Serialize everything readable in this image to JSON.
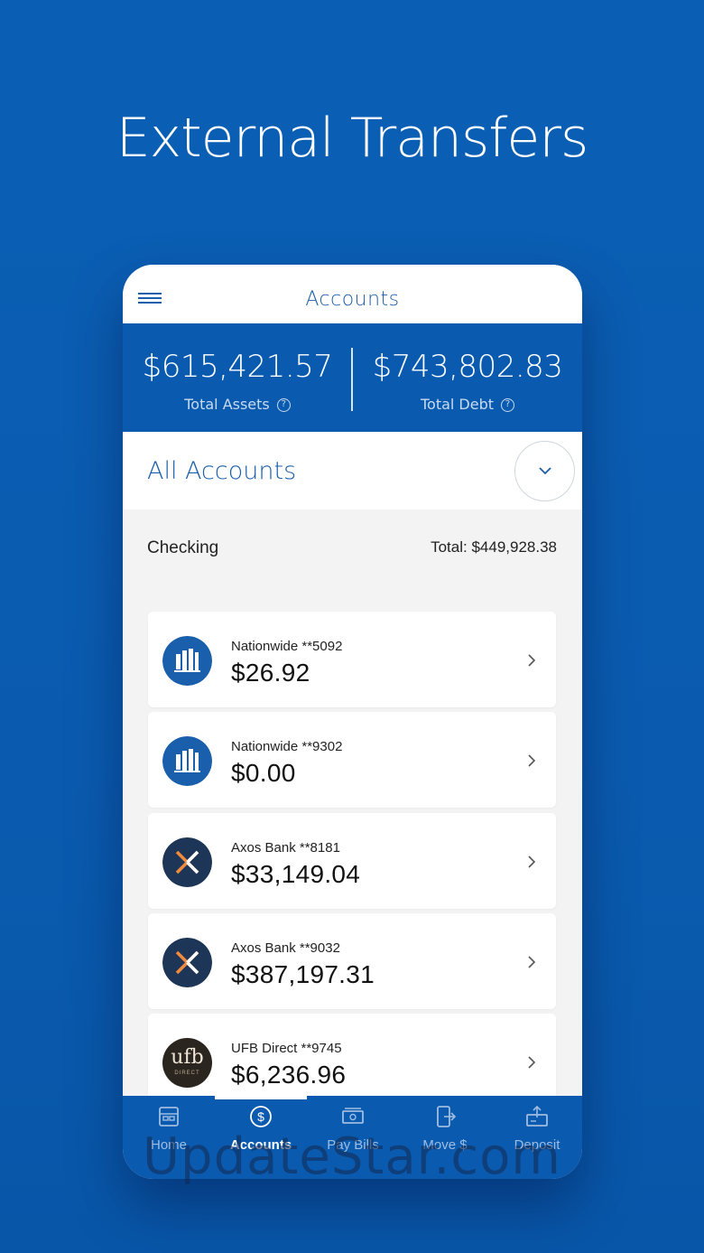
{
  "hero": {
    "title": "External Transfers"
  },
  "header": {
    "title": "Accounts"
  },
  "summary": {
    "assets_amount": "$615,421.57",
    "assets_label": "Total Assets",
    "debt_amount": "$743,802.83",
    "debt_label": "Total Debt",
    "help_glyph": "?"
  },
  "filter": {
    "label": "All Accounts"
  },
  "section": {
    "name": "Checking",
    "total": "Total:  $449,928.38"
  },
  "accounts": [
    {
      "name": "Nationwide **5092",
      "balance": "$26.92",
      "logo": "nationwide-logo"
    },
    {
      "name": "Nationwide **9302",
      "balance": "$0.00",
      "logo": "nationwide-logo"
    },
    {
      "name": "Axos Bank **8181",
      "balance": "$33,149.04",
      "logo": "axos-logo"
    },
    {
      "name": "Axos Bank **9032",
      "balance": "$387,197.31",
      "logo": "axos-logo"
    },
    {
      "name": "UFB Direct **9745",
      "balance": "$6,236.96",
      "logo": "ufb-logo"
    }
  ],
  "ufb_logo_text": {
    "main": "ufb",
    "sub": "DIRECT"
  },
  "nav": [
    {
      "label": "Home",
      "icon": "home-icon",
      "active": false
    },
    {
      "label": "Accounts",
      "icon": "dollar-circle-icon",
      "active": true
    },
    {
      "label": "Pay Bills",
      "icon": "bill-icon",
      "active": false
    },
    {
      "label": "Move $",
      "icon": "transfer-icon",
      "active": false
    },
    {
      "label": "Deposit",
      "icon": "deposit-icon",
      "active": false
    }
  ],
  "watermark": "UpdateStar.com",
  "colors": {
    "brand": "#0a5bb0",
    "accent_text": "#1a5fab",
    "axos_orange": "#f08a3c",
    "axos_navy": "#1d3557"
  }
}
